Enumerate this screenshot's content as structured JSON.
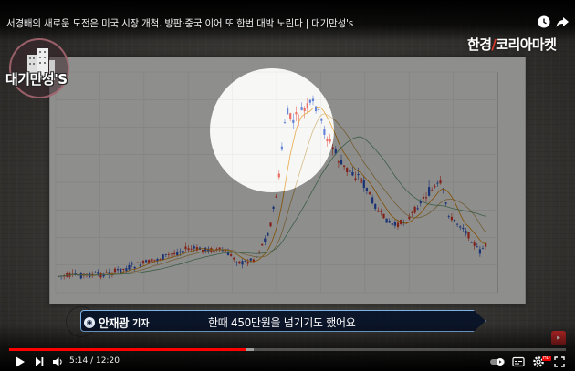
{
  "video": {
    "title": "서경배의 새로운 도전은 미국 시장 개척. 방판·중국 이어 또 한번 대박 노린다 | 대기만성's"
  },
  "overlay": {
    "channel_logo": "대기만성'S",
    "brand_name": "한경",
    "brand_sub": "코리아마켓"
  },
  "caption": {
    "speaker_name": "안재광",
    "speaker_role": "기자",
    "text": "한때 450만원을 넘기기도 했어요"
  },
  "controls": {
    "current_time": "5:14",
    "separator": " / ",
    "duration": "12:20",
    "progress_fraction": 0.424,
    "buffer_fraction": 0.44
  },
  "colors": {
    "progress": "#ff0000",
    "caption_border": "#7bb3e8",
    "candle_up": "#e0392b",
    "candle_down": "#2c56c9"
  },
  "icons": {
    "watch_later": "clock-icon",
    "share": "share-icon",
    "play": "play-icon",
    "next": "next-icon",
    "volume": "volume-icon",
    "autoplay": "autoplay-toggle-icon",
    "captions": "subtitles-icon",
    "settings": "gear-icon",
    "youtube": "youtube-icon",
    "fullscreen": "fullscreen-icon"
  }
}
